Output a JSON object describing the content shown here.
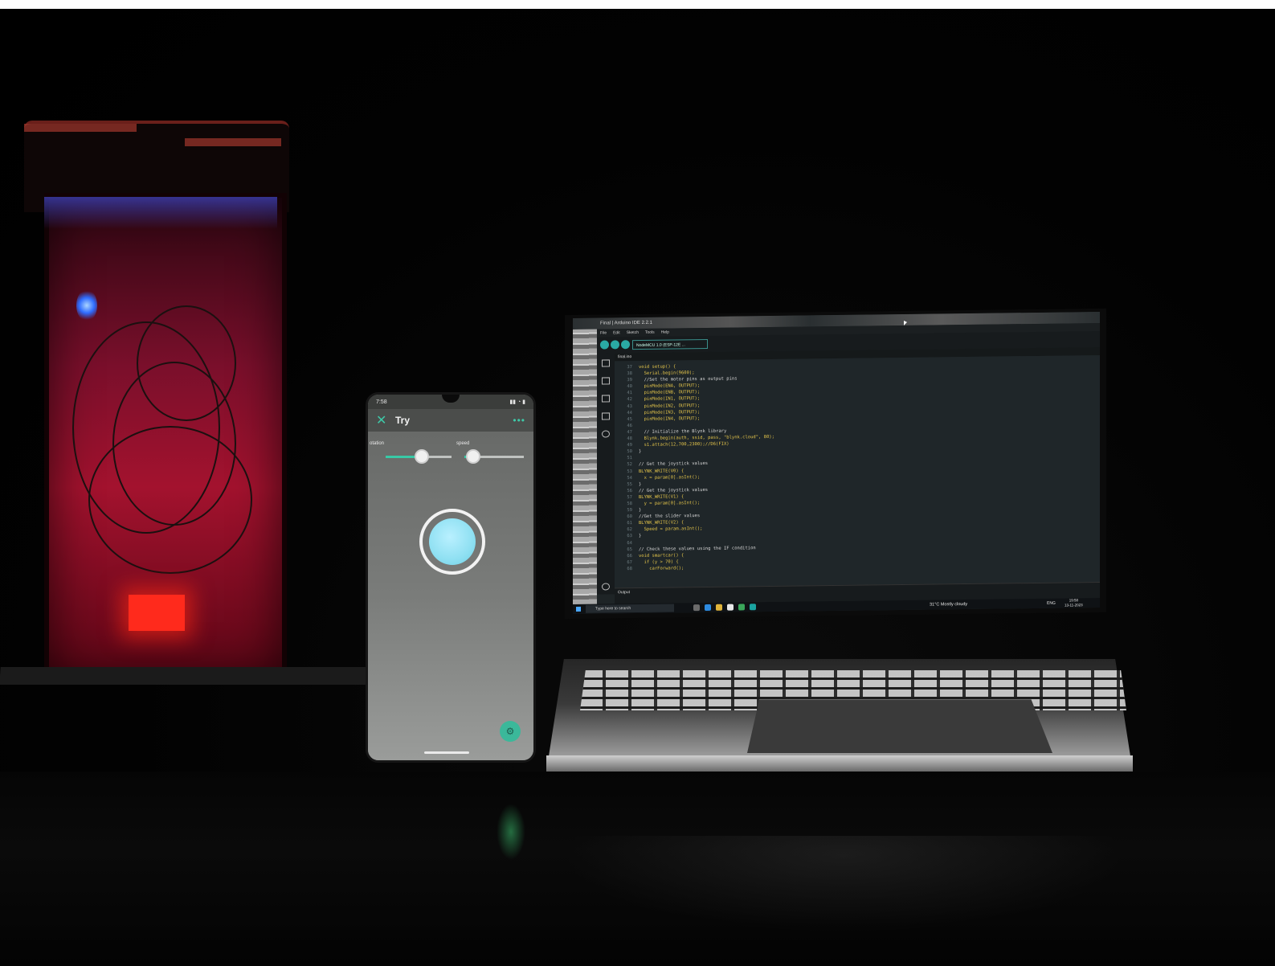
{
  "phone_app": {
    "status_time": "7:58",
    "title": "Try",
    "close_icon": "close-icon",
    "more_icon": "more-icon",
    "slider_left": {
      "label": "otation",
      "value": 0.55
    },
    "slider_right": {
      "label": "speed",
      "value": 0.15
    },
    "joystick_icon": "joystick-icon",
    "fab_icon": "wrench-icon"
  },
  "laptop": {
    "window_title": "Final | Arduino IDE 2.2.1",
    "menu": [
      "File",
      "Edit",
      "Sketch",
      "Tools",
      "Help"
    ],
    "board": "NodeMCU 1.0 (ESP-12E ...",
    "tab": "final.ino",
    "line_numbers": [
      "37",
      "38",
      "39",
      "40",
      "41",
      "42",
      "43",
      "44",
      "45",
      "46",
      "47",
      "48",
      "49",
      "50",
      "51",
      "52",
      "53",
      "54",
      "55",
      "56",
      "57",
      "58",
      "59",
      "60",
      "61",
      "62",
      "63",
      "64",
      "65",
      "66",
      "67",
      "68"
    ],
    "code_lines": [
      "void setup() {",
      "  Serial.begin(9600);",
      "  //Set the motor pins as output pins",
      "  pinMode(ENA, OUTPUT);",
      "  pinMode(ENB, OUTPUT);",
      "  pinMode(IN1, OUTPUT);",
      "  pinMode(IN2, OUTPUT);",
      "  pinMode(IN3, OUTPUT);",
      "  pinMode(IN4, OUTPUT);",
      "",
      "  // Initialize the Blynk library",
      "  Blynk.begin(auth, ssid, pass, \"blynk.cloud\", 80);",
      "  s1.attach(12,700,2300);//D6(FIX)",
      "}",
      "",
      "// Get the joystick values",
      "BLYNK_WRITE(V0) {",
      "  x = param[0].asInt();",
      "}",
      "// Get the joystick values",
      "BLYNK_WRITE(V1) {",
      "  y = param[0].asInt();",
      "}",
      "//Get the slider values",
      "BLYNK_WRITE(V2) {",
      "  Speed = param.asInt();",
      "}",
      "",
      "// Check these values using the IF condition",
      "void smartcar() {",
      "  if (y > 70) {",
      "    carForward();"
    ],
    "output_label": "Output",
    "search_placeholder": "Type here to search",
    "weather": "31°C Mostly cloudy",
    "language": "ENG",
    "clock_time": "19:58",
    "clock_date": "13-11-2023"
  }
}
